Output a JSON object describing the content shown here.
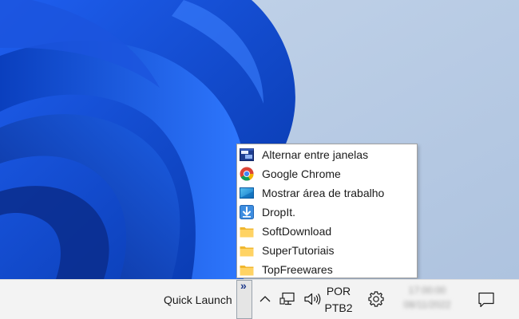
{
  "colors": {
    "taskbar_bg": "#f3f3f3",
    "menu_bg": "#ffffff",
    "wallpaper_bg": "#b9cde6",
    "bloom_blue": "#0a47d6"
  },
  "quick_launch_menu": {
    "items": [
      {
        "label": "Alternar entre janelas",
        "icon": "switch-windows-icon"
      },
      {
        "label": "Google Chrome",
        "icon": "chrome-icon"
      },
      {
        "label": "Mostrar área de trabalho",
        "icon": "show-desktop-icon"
      },
      {
        "label": "DropIt.",
        "icon": "dropit-icon"
      },
      {
        "label": "SoftDownload",
        "icon": "folder-icon"
      },
      {
        "label": "SuperTutoriais",
        "icon": "folder-icon"
      },
      {
        "label": "TopFreewares",
        "icon": "folder-icon"
      }
    ]
  },
  "taskbar": {
    "quick_launch_label": "Quick Launch",
    "chevron_glyph": "»",
    "lang_line1": "POR",
    "lang_line2": "PTB2",
    "clock_time": "17:00:00",
    "clock_date": "08/11/2022"
  }
}
